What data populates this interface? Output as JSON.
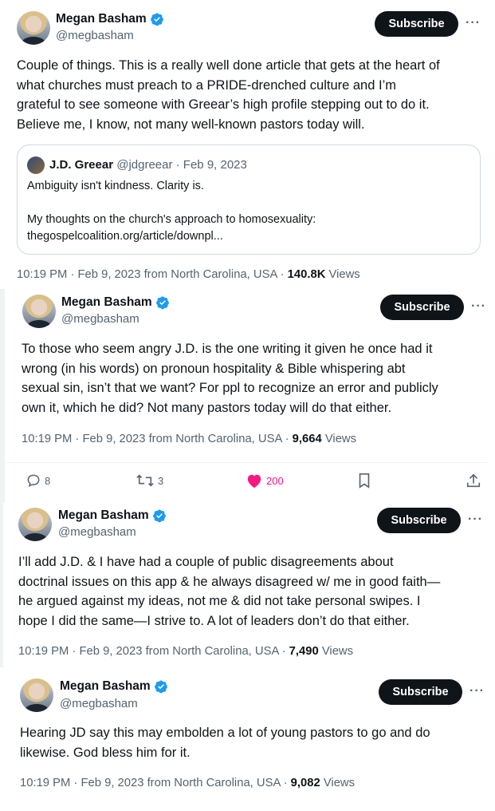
{
  "accent": "#1d9bf0",
  "like_color": "#f91880",
  "subscribe_label": "Subscribe",
  "more_label": "···",
  "tweets": [
    {
      "name": "Megan Basham",
      "handle": "@megbasham",
      "lines": [
        "Couple of things. This is a really well done article that gets at the heart of",
        "what churches must preach to a PRIDE-drenched culture and I’m",
        "grateful to see someone with Greear’s high profile stepping out to do it.",
        "Believe me, I know, not many well-known pastors today will."
      ],
      "meta": "10:19 PM · Feb 9, 2023 from North Carolina, USA · ",
      "views": "140.8K",
      "views_label": " Views",
      "quote": {
        "name": "J.D. Greear",
        "meta": " @jdgreear · Feb 9, 2023",
        "line1": "Ambiguity isn't kindness. Clarity is.",
        "line2": "My thoughts on the church's approach to homosexuality:",
        "line3": "thegospelcoalition.org/article/downpl..."
      }
    },
    {
      "name": "Megan Basham",
      "handle": "@megbasham",
      "lines": [
        "To those who seem angry J.D. is the one writing it given he once had it",
        "wrong (in his words) on pronoun hospitality & Bible whispering abt",
        "sexual sin, isn’t that we want? For ppl to recognize an error and publicly",
        "own it, which he did? Not many pastors today will do that either."
      ],
      "meta": "10:19 PM · Feb 9, 2023 from North Carolina, USA · ",
      "views": "9,664",
      "views_label": " Views",
      "actions": {
        "replies": "8",
        "retweets": "3",
        "likes": "200"
      }
    },
    {
      "name": "Megan Basham",
      "handle": "@megbasham",
      "lines": [
        "I’ll add J.D. & I have had a couple of public disagreements about",
        "doctrinal issues on this app & he always disagreed w/ me in good faith—",
        "he argued against my ideas, not me & did not take personal swipes. I",
        "hope I did the same—I strive to. A lot of leaders don’t do that either."
      ],
      "meta": "10:19 PM · Feb 9, 2023 from North Carolina, USA · ",
      "views": "7,490",
      "views_label": " Views"
    },
    {
      "name": "Megan Basham",
      "handle": "@megbasham",
      "lines": [
        "Hearing JD say this may embolden a lot of young pastors to go and do",
        "likewise. God bless him for it."
      ],
      "meta": "10:19 PM · Feb 9, 2023 from North Carolina, USA · ",
      "views": "9,082",
      "views_label": " Views"
    }
  ]
}
